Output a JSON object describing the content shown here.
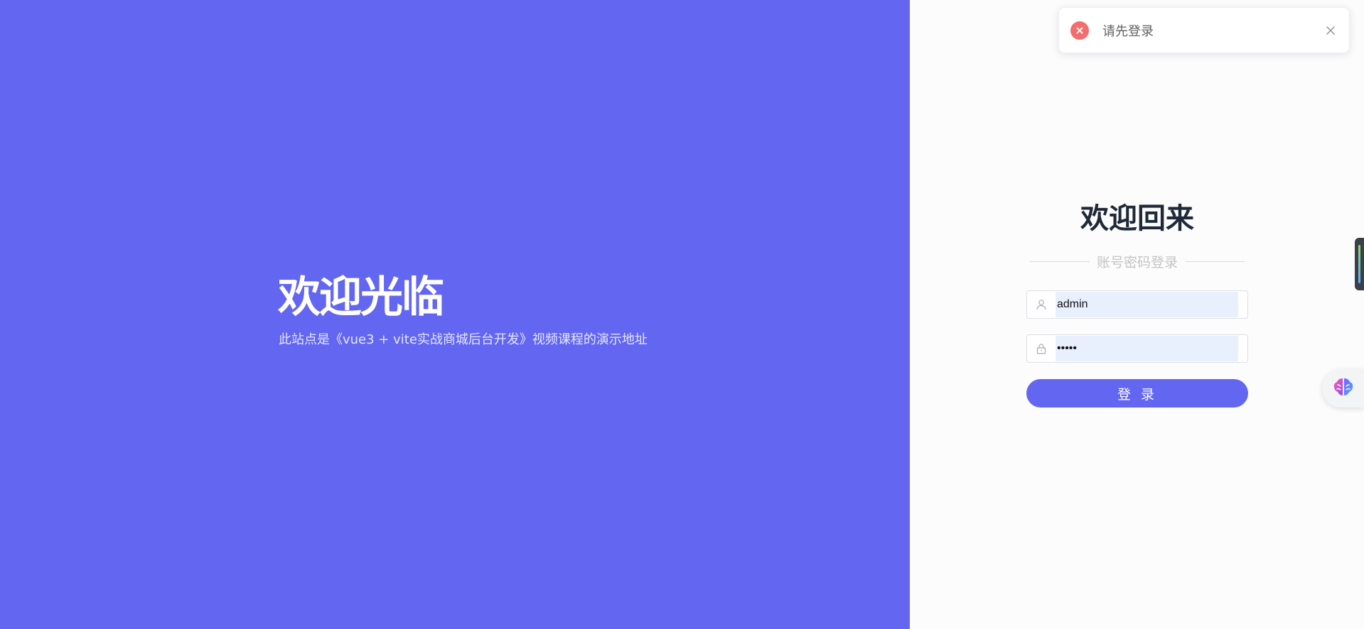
{
  "hero": {
    "title": "欢迎光临",
    "subtitle": "此站点是《vue3 + vite实战商城后台开发》视频课程的演示地址"
  },
  "login": {
    "title": "欢迎回来",
    "divider_text": "账号密码登录",
    "username": {
      "value": "admin",
      "icon": "user-icon"
    },
    "password": {
      "value": "admin",
      "icon": "lock-icon"
    },
    "submit_label": "登 录"
  },
  "toast": {
    "type": "error",
    "message": "请先登录",
    "icon": "error-circle-icon",
    "close_icon": "close-icon"
  },
  "colors": {
    "brand": "#6366f1",
    "error": "#f56c6c",
    "right_bg": "#fcfcfc",
    "input_autofill": "#e8f0fe"
  },
  "floating": {
    "assistant_icon": "brain-icon",
    "side_handle": "side-panel-handle"
  }
}
